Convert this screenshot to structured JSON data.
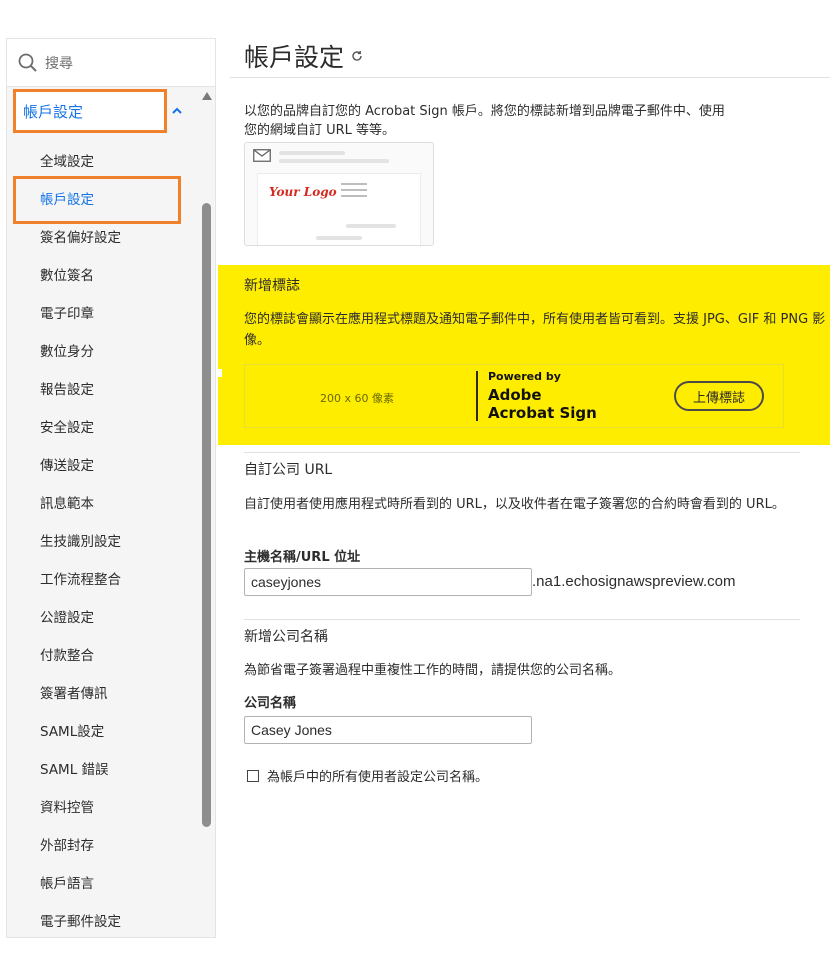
{
  "sidebar": {
    "search_placeholder": "搜尋",
    "group_label": "帳戶設定",
    "items": [
      {
        "label": "全域設定"
      },
      {
        "label": "帳戶設定"
      },
      {
        "label": "簽名偏好設定"
      },
      {
        "label": "數位簽名"
      },
      {
        "label": "電子印章"
      },
      {
        "label": "數位身分"
      },
      {
        "label": "報告設定"
      },
      {
        "label": "安全設定"
      },
      {
        "label": "傳送設定"
      },
      {
        "label": "訊息範本"
      },
      {
        "label": "生技識別設定"
      },
      {
        "label": "工作流程整合"
      },
      {
        "label": "公證設定"
      },
      {
        "label": "付款整合"
      },
      {
        "label": "簽署者傳訊"
      },
      {
        "label": "SAML設定"
      },
      {
        "label": "SAML 錯誤"
      },
      {
        "label": "資料控管"
      },
      {
        "label": "外部封存"
      },
      {
        "label": "帳戶語言"
      },
      {
        "label": "電子郵件設定"
      }
    ],
    "active_index": 1
  },
  "main": {
    "title": "帳戶設定",
    "intro_line1": "以您的品牌自訂您的 Acrobat Sign 帳戶。將您的標誌新增到品牌電子郵件中、使用",
    "intro_line2": "您的網域自訂 URL 等等。",
    "preview_logo_text": "Your Logo",
    "add_logo": {
      "heading": "新增標誌",
      "body": "您的標誌會顯示在應用程式標題及通知電子郵件中，所有使用者皆可看到。支援 JPG、GIF 和 PNG 影像。",
      "size_hint": "200 x 60 像素",
      "powered_by": "Powered by",
      "brand_line1": "Adobe",
      "brand_line2": "Acrobat Sign",
      "upload_button": "上傳標誌",
      "highlight_color": "#ffed00"
    },
    "custom_url": {
      "heading": "自訂公司 URL",
      "description": "自訂使用者使用應用程式時所看到的 URL，以及收件者在電子簽署您的合約時會看到的 URL。",
      "field_label": "主機名稱/URL 位址",
      "host_value": "caseyjones",
      "domain_suffix": ".na1.echosignawspreview.com"
    },
    "company_name": {
      "heading": "新增公司名稱",
      "description": "為節省電子簽署過程中重複性工作的時間，請提供您的公司名稱。",
      "field_label": "公司名稱",
      "value": "Casey Jones",
      "checkbox_label": "為帳戶中的所有使用者設定公司名稱。",
      "checkbox_checked": false
    }
  },
  "colors": {
    "accent": "#1473e6",
    "highlight_border": "#f0802a"
  }
}
